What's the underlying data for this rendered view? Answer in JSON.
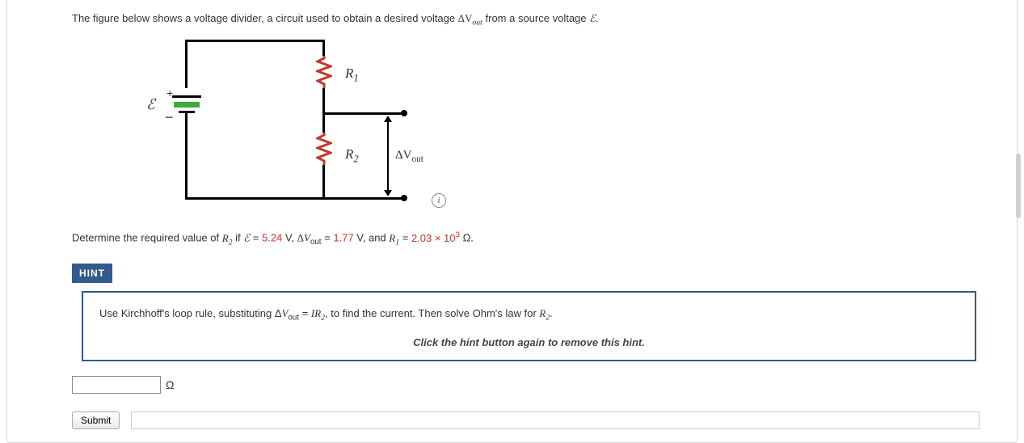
{
  "intro": {
    "prefix": "The figure below shows a voltage divider, a circuit used to obtain a desired voltage ",
    "dv": "ΔV",
    "dv_sub": "out",
    "mid": " from a source voltage ",
    "eps": "ℰ",
    "suffix": "."
  },
  "figure": {
    "eps": "ℰ",
    "plus": "+",
    "minus": "−",
    "r1": "R",
    "r1_sub": "1",
    "r2": "R",
    "r2_sub": "2",
    "dv": "ΔV",
    "dv_sub": "out",
    "info": "i"
  },
  "determine": {
    "pre": "Determine the required value of ",
    "r2": "R",
    "r2_sub": "2",
    "if": " if ",
    "eps": "ℰ",
    "eq1": " = ",
    "val1": "5.24",
    "v1": " V, ",
    "dv": "ΔV",
    "dv_sub": "out",
    "eq2": " = ",
    "val2": "1.77",
    "v2": " V, and ",
    "r1": "R",
    "r1_sub": "1",
    "eq3": " = ",
    "val3": "2.03 × 10",
    "exp3": "3",
    "ohm": " Ω."
  },
  "hint_button": "HINT",
  "hint": {
    "pre": "Use Kirchhoff's loop rule, substituting ",
    "dv": "ΔV",
    "dv_sub": "out",
    "eq": " = ",
    "ir": "IR",
    "ir_sub": "2",
    "post": ", to find the current. Then solve Ohm's law for ",
    "r2": "R",
    "r2_sub": "2",
    "end": ".",
    "close": "Click the hint button again to remove this hint."
  },
  "answer": {
    "value": "",
    "unit": "Ω"
  },
  "submit": {
    "label": "Submit"
  }
}
